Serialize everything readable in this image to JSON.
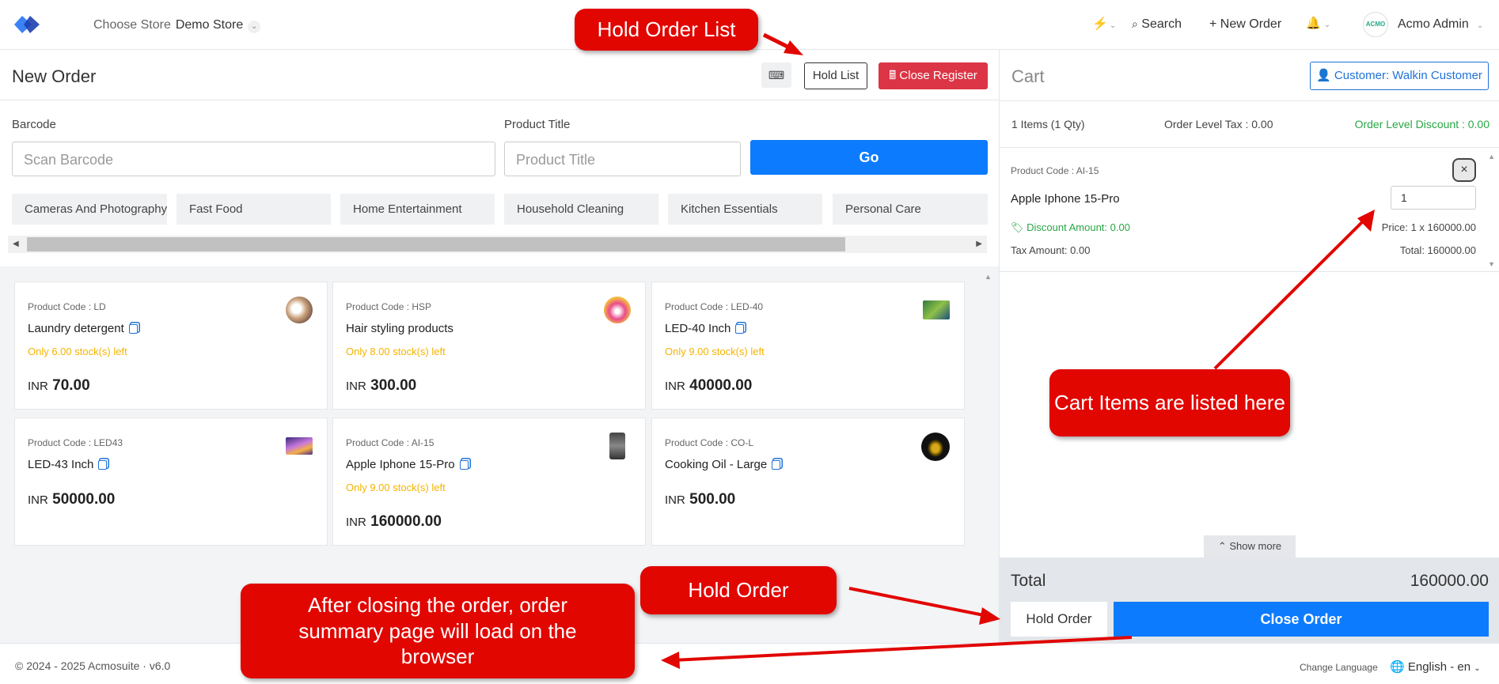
{
  "topbar": {
    "store_label": "Choose Store",
    "store_value": "Demo Store",
    "search_label": "Search",
    "new_order_label": "+ New Order",
    "user_name": "Acmo Admin",
    "avatar_text": "ACMO"
  },
  "order": {
    "title": "New Order",
    "hold_list_label": "Hold List",
    "close_register_label": "Close Register",
    "barcode_label": "Barcode",
    "barcode_placeholder": "Scan Barcode",
    "title_label": "Product Title",
    "title_placeholder": "Product Title",
    "go_label": "Go",
    "categories": [
      "Cameras And Photography",
      "Fast Food",
      "Home Entertainment",
      "Household Cleaning",
      "Kitchen Essentials",
      "Personal Care"
    ]
  },
  "products": [
    {
      "code": "Product Code : LD",
      "name": "Laundry detergent",
      "stock": "Only 6.00 stock(s) left",
      "currency": "INR",
      "price": "70.00"
    },
    {
      "code": "Product Code : HSP",
      "name": "Hair styling products",
      "stock": "Only 8.00 stock(s) left",
      "currency": "INR",
      "price": "300.00"
    },
    {
      "code": "Product Code : LED-40",
      "name": "LED-40 Inch",
      "stock": "Only 9.00 stock(s) left",
      "currency": "INR",
      "price": "40000.00"
    },
    {
      "code": "Product Code : LED43",
      "name": "LED-43 Inch",
      "stock": "",
      "currency": "INR",
      "price": "50000.00"
    },
    {
      "code": "Product Code : AI-15",
      "name": "Apple Iphone 15-Pro",
      "stock": "Only 9.00 stock(s) left",
      "currency": "INR",
      "price": "160000.00"
    },
    {
      "code": "Product Code : CO-L",
      "name": "Cooking Oil - Large",
      "stock": "",
      "currency": "INR",
      "price": "500.00"
    }
  ],
  "cart": {
    "title": "Cart",
    "customer_label": "Customer: Walkin Customer",
    "items_summary": "1 Items (1 Qty)",
    "order_tax": "Order Level Tax : 0.00",
    "order_discount": "Order Level Discount : 0.00",
    "item": {
      "code": "Product Code : AI-15",
      "name": "Apple Iphone 15-Pro",
      "qty": "1",
      "discount": "Discount Amount: 0.00",
      "price": "Price: 1 x 160000.00",
      "tax": "Tax Amount: 0.00",
      "total": "Total: 160000.00"
    },
    "show_more": "Show more",
    "total_label": "Total",
    "total_value": "160000.00",
    "hold_order_label": "Hold Order",
    "close_order_label": "Close Order"
  },
  "footer": {
    "copyright": "© 2024 - 2025 Acmosuite · v6.0",
    "change_language": "Change Language",
    "language": "English - en"
  },
  "callouts": {
    "hold_order_list": "Hold Order List",
    "cart_items": "Cart Items are listed here",
    "hold_order": "Hold Order",
    "after_closing": "After closing the order, order summary page will load on the browser"
  }
}
